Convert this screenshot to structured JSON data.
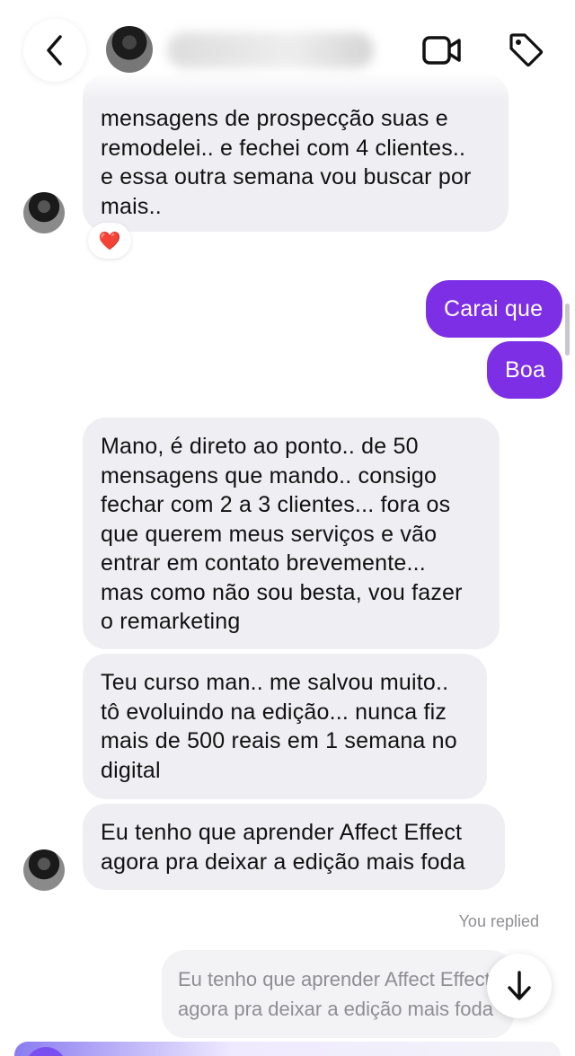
{
  "header": {
    "back_icon": "chevron-left-icon",
    "video_icon": "video-camera-icon",
    "tag_icon": "tag-icon"
  },
  "messages": {
    "m1": {
      "lines": [
        "mensagens de prospecção suas e",
        "remodelei.. e fechei com 4 clientes..",
        "e essa outra semana vou buscar por",
        "mais.."
      ],
      "reaction": "❤️"
    },
    "m2": {
      "text": "Carai que"
    },
    "m3": {
      "text": "Boa"
    },
    "m4": {
      "lines": [
        "Mano, é direto ao ponto.. de 50",
        "mensagens que mando.. consigo",
        "fechar com 2 a 3 clientes... fora os",
        "que querem meus serviços e vão",
        "entrar em contato brevemente...",
        "mas como não sou besta, vou fazer",
        "o remarketing"
      ]
    },
    "m5": {
      "lines": [
        "Teu curso man.. me salvou muito..",
        "tô evoluindo na edição... nunca fiz",
        "mais de 500 reais em 1 semana no",
        "digital"
      ]
    },
    "m6": {
      "lines": [
        "Eu tenho que aprender Affect Effect",
        "agora pra deixar a edição mais foda"
      ]
    }
  },
  "reply": {
    "label": "You replied",
    "preview_lines": [
      "Eu tenho que aprender Affect Effect",
      "agora pra deixar a edição mais foda"
    ]
  },
  "colors": {
    "outgoing_bubble": "#7d2fe6",
    "incoming_bubble": "#efeff3",
    "meta_text": "#8e8e93"
  }
}
